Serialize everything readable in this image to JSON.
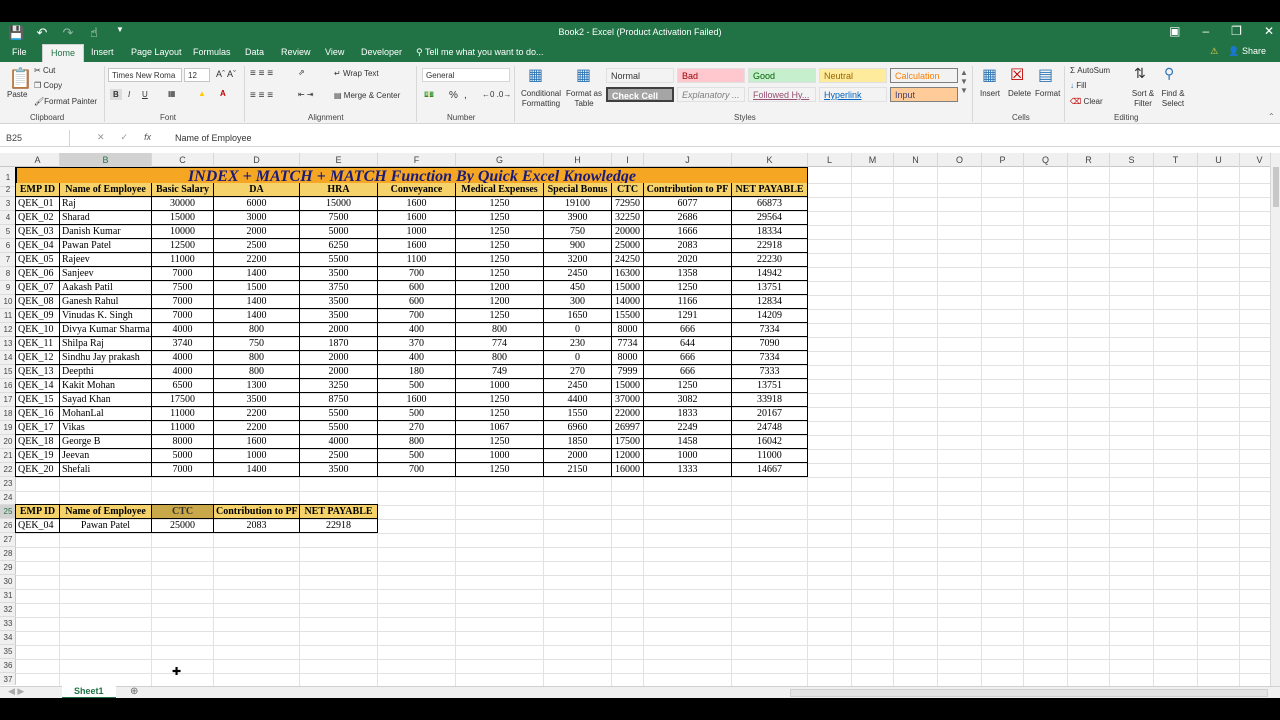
{
  "window": {
    "title": "Book2 - Excel (Product Activation Failed)"
  },
  "tabs": [
    "File",
    "Home",
    "Insert",
    "Page Layout",
    "Formulas",
    "Data",
    "Review",
    "View",
    "Developer"
  ],
  "tellme": "Tell me what you want to do...",
  "share": "Share",
  "ribbon": {
    "clipboard": {
      "paste": "Paste",
      "cut": "Cut",
      "copy": "Copy",
      "format_painter": "Format Painter",
      "label": "Clipboard"
    },
    "font": {
      "name": "Times New Roma",
      "size": "12",
      "bold": "B",
      "italic": "I",
      "underline": "U",
      "label": "Font"
    },
    "alignment": {
      "wrap": "Wrap Text",
      "merge": "Merge & Center",
      "label": "Alignment"
    },
    "number": {
      "format": "General",
      "percent": "%",
      "comma": ",",
      "label": "Number"
    },
    "styles": {
      "conditional": "Conditional Formatting",
      "format_table": "Format as Table",
      "label": "Styles",
      "boxes": [
        {
          "label": "Normal",
          "bg": "#ffffff",
          "fg": "#000000"
        },
        {
          "label": "Bad",
          "bg": "#ffc7ce",
          "fg": "#9c0006"
        },
        {
          "label": "Good",
          "bg": "#c6efce",
          "fg": "#006100"
        },
        {
          "label": "Neutral",
          "bg": "#ffeb9c",
          "fg": "#9c6500"
        },
        {
          "label": "Calculation",
          "bg": "#f2f2f2",
          "fg": "#fa7d00"
        },
        {
          "label": "Check Cell",
          "bg": "#a5a5a5",
          "fg": "#ffffff"
        },
        {
          "label": "Explanatory ...",
          "bg": "#ffffff",
          "fg": "#7f7f7f"
        },
        {
          "label": "Followed Hy...",
          "bg": "#ffffff",
          "fg": "#954f72"
        },
        {
          "label": "Hyperlink",
          "bg": "#ffffff",
          "fg": "#0563c1"
        },
        {
          "label": "Input",
          "bg": "#ffcc99",
          "fg": "#3f3f76"
        }
      ]
    },
    "cells": {
      "insert": "Insert",
      "delete": "Delete",
      "format": "Format",
      "label": "Cells"
    },
    "editing": {
      "autosum": "AutoSum",
      "fill": "Fill",
      "clear": "Clear",
      "sort": "Sort & Filter",
      "find": "Find & Select",
      "label": "Editing"
    }
  },
  "formula_bar": {
    "name_box": "B25",
    "formula": "Name of Employee",
    "fx": "fx"
  },
  "columns": [
    "A",
    "B",
    "C",
    "D",
    "E",
    "F",
    "G",
    "H",
    "I",
    "J",
    "K",
    "L",
    "M",
    "N",
    "O",
    "P",
    "Q",
    "R",
    "S",
    "T",
    "U",
    "V"
  ],
  "sheet": {
    "title": "INDEX + MATCH + MATCH Function By Quick Excel Knowledge",
    "headers": [
      "EMP ID",
      "Name of Employee",
      "Basic Salary",
      "DA",
      "HRA",
      "Conveyance",
      "Medical Expenses",
      "Special Bonus",
      "CTC",
      "Contribution to PF",
      "NET PAYABLE"
    ],
    "rows": [
      [
        "QEK_01",
        "Raj",
        "30000",
        "6000",
        "15000",
        "1600",
        "1250",
        "19100",
        "72950",
        "6077",
        "66873"
      ],
      [
        "QEK_02",
        "Sharad",
        "15000",
        "3000",
        "7500",
        "1600",
        "1250",
        "3900",
        "32250",
        "2686",
        "29564"
      ],
      [
        "QEK_03",
        "Danish Kumar",
        "10000",
        "2000",
        "5000",
        "1000",
        "1250",
        "750",
        "20000",
        "1666",
        "18334"
      ],
      [
        "QEK_04",
        "Pawan Patel",
        "12500",
        "2500",
        "6250",
        "1600",
        "1250",
        "900",
        "25000",
        "2083",
        "22918"
      ],
      [
        "QEK_05",
        "Rajeev",
        "11000",
        "2200",
        "5500",
        "1100",
        "1250",
        "3200",
        "24250",
        "2020",
        "22230"
      ],
      [
        "QEK_06",
        "Sanjeev",
        "7000",
        "1400",
        "3500",
        "700",
        "1250",
        "2450",
        "16300",
        "1358",
        "14942"
      ],
      [
        "QEK_07",
        "Aakash Patil",
        "7500",
        "1500",
        "3750",
        "600",
        "1200",
        "450",
        "15000",
        "1250",
        "13751"
      ],
      [
        "QEK_08",
        "Ganesh Rahul",
        "7000",
        "1400",
        "3500",
        "600",
        "1200",
        "300",
        "14000",
        "1166",
        "12834"
      ],
      [
        "QEK_09",
        "Vinudas K. Singh",
        "7000",
        "1400",
        "3500",
        "700",
        "1250",
        "1650",
        "15500",
        "1291",
        "14209"
      ],
      [
        "QEK_10",
        "Divya Kumar Sharma",
        "4000",
        "800",
        "2000",
        "400",
        "800",
        "0",
        "8000",
        "666",
        "7334"
      ],
      [
        "QEK_11",
        "Shilpa Raj",
        "3740",
        "750",
        "1870",
        "370",
        "774",
        "230",
        "7734",
        "644",
        "7090"
      ],
      [
        "QEK_12",
        "Sindhu Jay prakash",
        "4000",
        "800",
        "2000",
        "400",
        "800",
        "0",
        "8000",
        "666",
        "7334"
      ],
      [
        "QEK_13",
        "Deepthi",
        "4000",
        "800",
        "2000",
        "180",
        "749",
        "270",
        "7999",
        "666",
        "7333"
      ],
      [
        "QEK_14",
        "Kakit Mohan",
        "6500",
        "1300",
        "3250",
        "500",
        "1000",
        "2450",
        "15000",
        "1250",
        "13751"
      ],
      [
        "QEK_15",
        "Sayad Khan",
        "17500",
        "3500",
        "8750",
        "1600",
        "1250",
        "4400",
        "37000",
        "3082",
        "33918"
      ],
      [
        "QEK_16",
        "MohanLal",
        "11000",
        "2200",
        "5500",
        "500",
        "1250",
        "1550",
        "22000",
        "1833",
        "20167"
      ],
      [
        "QEK_17",
        "Vikas",
        "11000",
        "2200",
        "5500",
        "270",
        "1067",
        "6960",
        "26997",
        "2249",
        "24748"
      ],
      [
        "QEK_18",
        "George B",
        "8000",
        "1600",
        "4000",
        "800",
        "1250",
        "1850",
        "17500",
        "1458",
        "16042"
      ],
      [
        "QEK_19",
        "Jeevan",
        "5000",
        "1000",
        "2500",
        "500",
        "1000",
        "2000",
        "12000",
        "1000",
        "11000"
      ],
      [
        "QEK_20",
        "Shefali",
        "7000",
        "1400",
        "3500",
        "700",
        "1250",
        "2150",
        "16000",
        "1333",
        "14667"
      ]
    ],
    "lookup": {
      "headers": [
        "EMP ID",
        "Name of Employee",
        "CTC",
        "Contribution to PF",
        "NET PAYABLE"
      ],
      "values": [
        "QEK_04",
        "Pawan Patel",
        "25000",
        "2083",
        "22918"
      ]
    }
  },
  "sheet_tab": "Sheet1"
}
